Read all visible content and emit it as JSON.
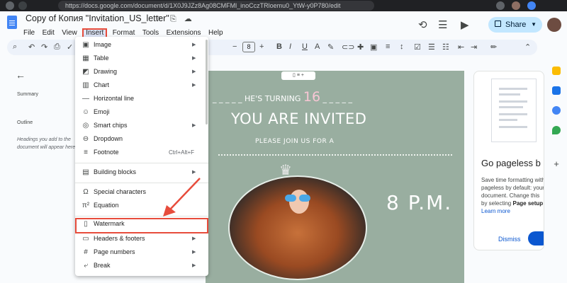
{
  "browser": {
    "url": "https://docs.google.com/document/d/1X0J9JZz8Ag08CMFMl_inoCczTRloemu0_YtW-y0P780/edit"
  },
  "doc": {
    "title": "Copy of Копия \"Invitation_US_letter\"",
    "title_icons": "☆ ⎘ ☁"
  },
  "menubar": [
    "File",
    "Edit",
    "View",
    "Insert",
    "Format",
    "Tools",
    "Extensions",
    "Help"
  ],
  "header": {
    "share_label": "Share"
  },
  "toolbar": {
    "font_size": "8"
  },
  "outline_panel": {
    "summary_label": "Summary",
    "outline_label": "Outline",
    "hint": "Headings you add to the document will appear here."
  },
  "insert_menu": {
    "items": [
      {
        "label": "Image",
        "icon": "image-icon",
        "glyph": "▣",
        "submenu": true
      },
      {
        "label": "Table",
        "icon": "table-icon",
        "glyph": "▦",
        "submenu": true
      },
      {
        "label": "Drawing",
        "icon": "drawing-icon",
        "glyph": "◩",
        "submenu": true
      },
      {
        "label": "Chart",
        "icon": "chart-icon",
        "glyph": "▥",
        "submenu": true
      },
      {
        "label": "Horizontal line",
        "icon": "horizontal-line-icon",
        "glyph": "—",
        "submenu": false
      },
      {
        "label": "Emoji",
        "icon": "emoji-icon",
        "glyph": "☺",
        "submenu": false
      },
      {
        "label": "Smart chips",
        "icon": "smart-chips-icon",
        "glyph": "◎",
        "submenu": true
      },
      {
        "label": "Dropdown",
        "icon": "dropdown-icon",
        "glyph": "⊖",
        "submenu": false
      },
      {
        "label": "Footnote",
        "icon": "footnote-icon",
        "glyph": "≡",
        "submenu": false,
        "shortcut": "Ctrl+Alt+F"
      },
      {
        "label": "Building blocks",
        "icon": "building-blocks-icon",
        "glyph": "▤",
        "submenu": true
      },
      {
        "label": "Special characters",
        "icon": "special-characters-icon",
        "glyph": "Ω",
        "submenu": false
      },
      {
        "label": "Equation",
        "icon": "equation-icon",
        "glyph": "π²",
        "submenu": false
      },
      {
        "label": "Watermark",
        "icon": "watermark-icon",
        "glyph": "▯",
        "submenu": false
      },
      {
        "label": "Headers & footers",
        "icon": "headers-footers-icon",
        "glyph": "▭",
        "submenu": true
      },
      {
        "label": "Page numbers",
        "icon": "page-numbers-icon",
        "glyph": "#",
        "submenu": true
      },
      {
        "label": "Break",
        "icon": "break-icon",
        "glyph": "⤶",
        "submenu": true
      }
    ]
  },
  "invitation": {
    "turning_prefix": "_ _ _ _ _ HE'S TURNING",
    "turning_number": "16",
    "turning_suffix": "_ _ _ _ _",
    "invited": "YOU ARE INVITED",
    "please": "PLEASE JOIN US FOR A",
    "time": "8 P.M."
  },
  "side_card": {
    "title": "Go pageless b",
    "body": "Save time formatting with pageless by default: your document. Change this by selecting",
    "body_bold": "Page setup",
    "learn_more": "Learn more",
    "dismiss": "Dismiss"
  },
  "colors": {
    "highlight_box": "#e74c3c",
    "page_background": "#99aea0",
    "share_button": "#c2e7ff",
    "accent_blue": "#0b57d0"
  }
}
